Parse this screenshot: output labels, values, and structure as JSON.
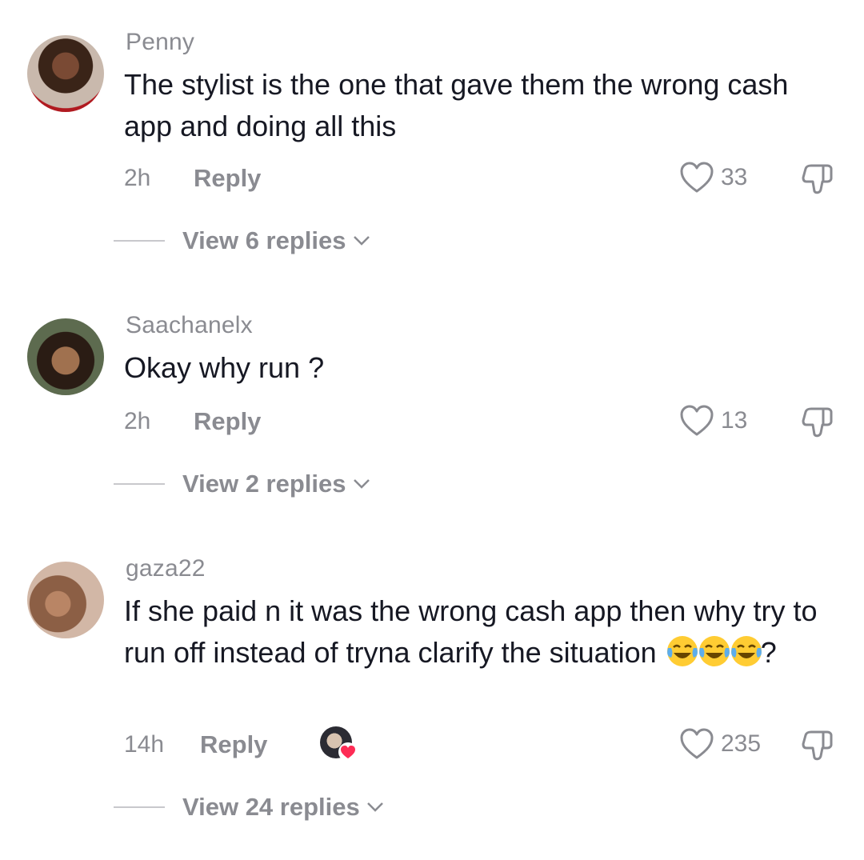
{
  "comments": [
    {
      "username": "Penny",
      "text": "The stylist is the one that gave them the wrong cash app and doing all this",
      "time": "2h",
      "reply_label": "Reply",
      "likes": "33",
      "view_replies": "View 6 replies"
    },
    {
      "username": "Saachanelx",
      "text": "Okay why run ?",
      "time": "2h",
      "reply_label": "Reply",
      "likes": "13",
      "view_replies": "View 2 replies"
    },
    {
      "username": "gaza22",
      "text": "If she paid n it was the wrong cash app then why try to run off instead of tryna clarify the situation",
      "text_suffix": "?",
      "emojis": [
        "face-with-tears-of-joy",
        "face-with-tears-of-joy",
        "face-with-tears-of-joy"
      ],
      "time": "14h",
      "reply_label": "Reply",
      "likes": "235",
      "view_replies": "View 24 replies"
    }
  ],
  "colors": {
    "primary_text": "#161823",
    "secondary_text": "#8a8b91",
    "heart_badge": "#fe2c55"
  }
}
